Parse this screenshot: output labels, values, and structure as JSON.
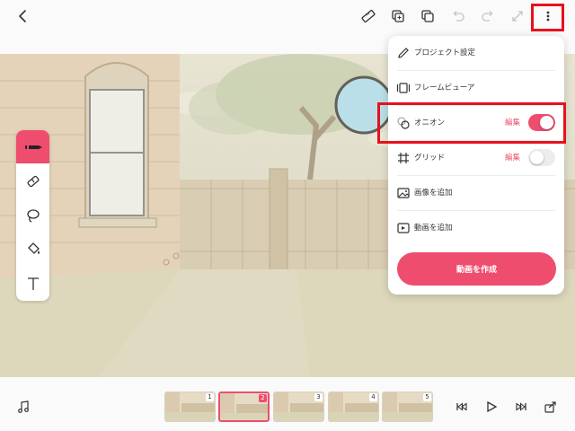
{
  "menu": {
    "items": [
      {
        "label": "プロジェクト設定"
      },
      {
        "label": "フレームビューア"
      },
      {
        "label": "オニオン",
        "edit": "編集",
        "toggle": "on"
      },
      {
        "label": "グリッド",
        "edit": "編集",
        "toggle": "off"
      },
      {
        "label": "画像を追加"
      },
      {
        "label": "動画を追加"
      }
    ],
    "create_button": "動画を作成"
  },
  "timeline": {
    "frames": [
      "1",
      "2",
      "3",
      "4",
      "5"
    ],
    "selected_frame": "2"
  },
  "colors": {
    "accent": "#ee4d6e",
    "highlight": "#e8101d"
  },
  "icons": {
    "top": [
      "back-icon",
      "ruler-icon",
      "copy-frame-icon",
      "layers-icon",
      "undo-icon",
      "redo-icon",
      "expand-icon",
      "more-icon"
    ],
    "tools": [
      "pen-icon",
      "eraser-icon",
      "lasso-icon",
      "fill-bucket-icon",
      "text-icon"
    ],
    "bottom": [
      "music-icon",
      "skip-to-start-icon",
      "play-icon",
      "skip-to-end-icon",
      "export-icon"
    ]
  }
}
